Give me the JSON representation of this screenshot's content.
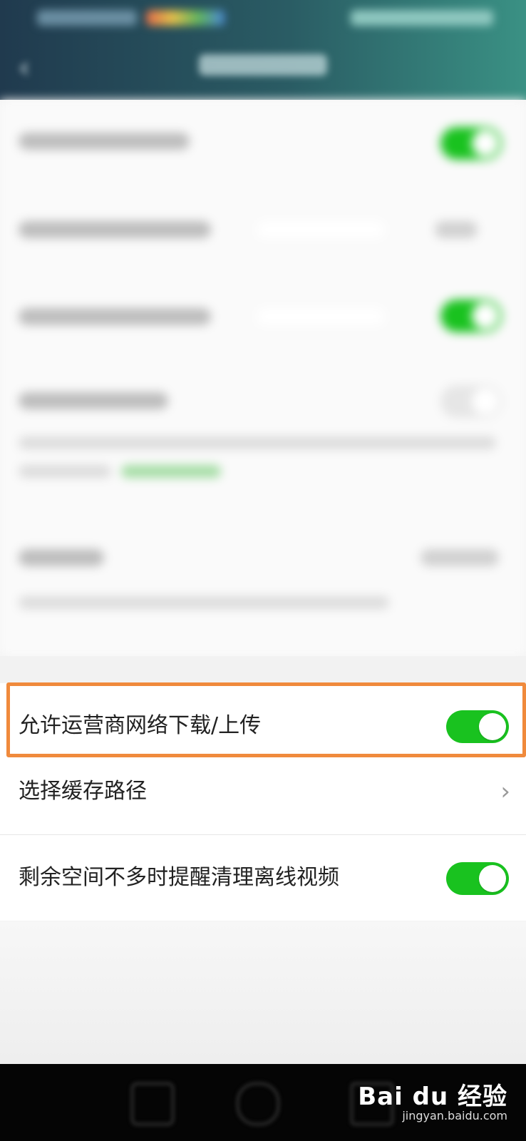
{
  "settings": {
    "items": [
      {
        "label": "允许运营商网络下载/上传",
        "toggle": true
      },
      {
        "label": "选择缓存路径",
        "chevron": "›"
      },
      {
        "label": "剩余空间不多时提醒清理离线视频",
        "toggle": true
      }
    ]
  },
  "watermark": {
    "brand": "Bai du 经验",
    "url": "jingyan.baidu.com"
  },
  "colors": {
    "toggle_on": "#19c21f",
    "highlight_border": "#f08a3c",
    "header_start": "#203a4e",
    "header_end": "#3a9184"
  },
  "icons": {
    "back": "back-arrow-icon",
    "chevron": "chevron-right-icon",
    "nav_home": "home-circle-icon",
    "nav_back": "back-triangle-icon",
    "nav_recents": "recents-square-icon"
  }
}
